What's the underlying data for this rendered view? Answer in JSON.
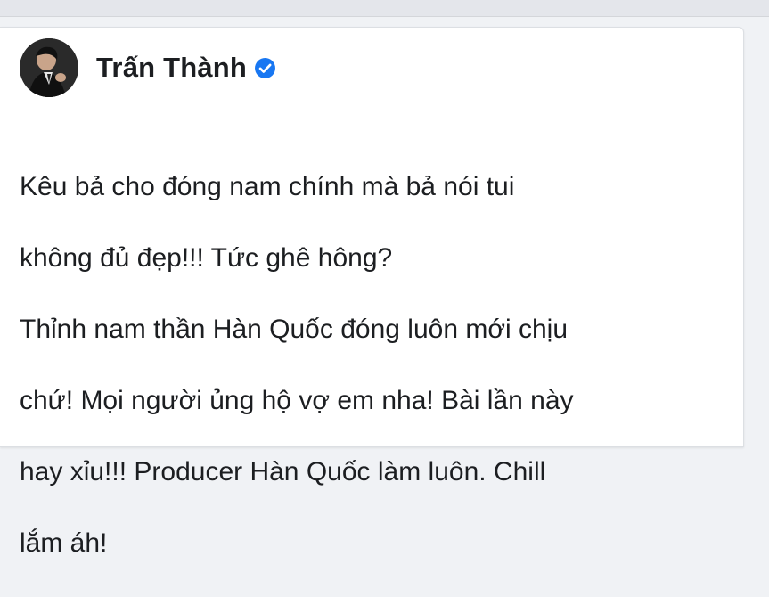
{
  "post": {
    "author_name": "Trấn Thành",
    "verified": true,
    "lines": [
      "Kêu bả cho đóng nam chính mà bả nói tui",
      "không đủ đẹp!!! Tức ghê hông?",
      "Thỉnh nam thần Hàn Quốc đóng luôn mới chịu",
      "chứ! Mọi người ủng hộ vợ em nha! Bài lần này",
      "hay xỉu!!! Producer Hàn Quốc làm luôn. Chill",
      "lắm áh!"
    ]
  },
  "colors": {
    "background": "#f0f2f5",
    "card": "#ffffff",
    "text": "#1c1e21",
    "verified_badge": "#1877f2"
  },
  "icons": {
    "verified": "verified-check-icon",
    "avatar": "profile-photo"
  }
}
